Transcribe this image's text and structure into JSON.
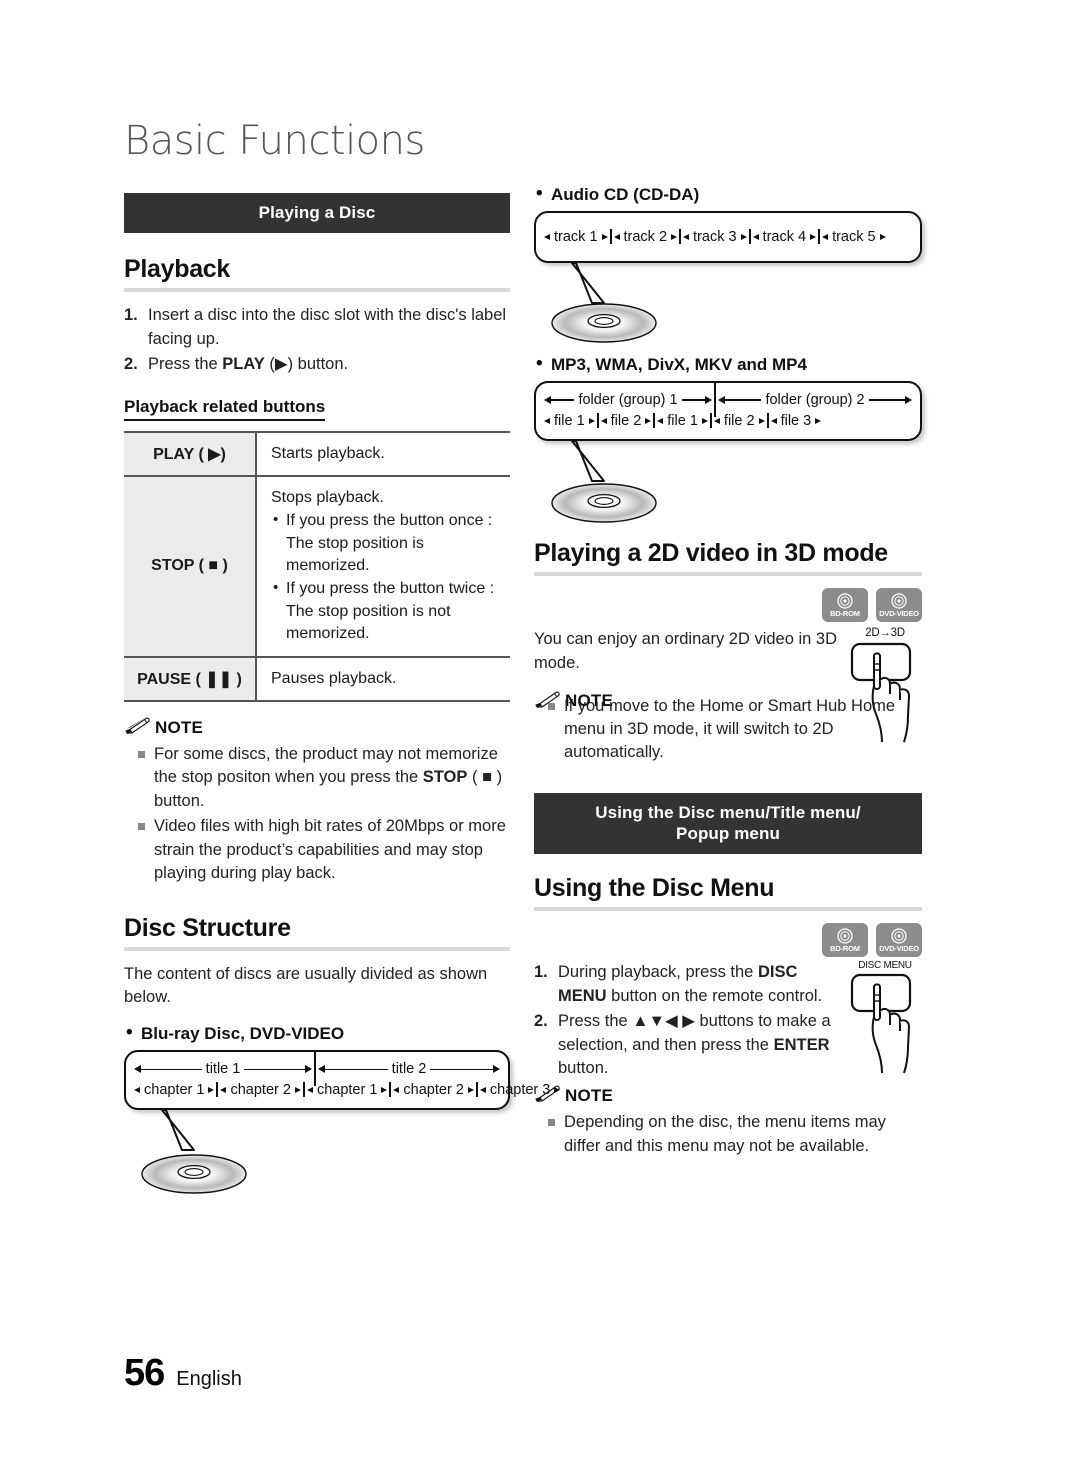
{
  "chapter": {
    "title": "Basic Functions"
  },
  "footer": {
    "page_number": "56",
    "language": "English"
  },
  "left": {
    "section_bar": "Playing a Disc",
    "playback": {
      "heading": "Playback",
      "steps": [
        {
          "num": "1.",
          "text": "Insert a disc into the disc slot with the disc's label facing up."
        },
        {
          "num": "2.",
          "pre": "Press the ",
          "bold": "PLAY",
          "post": " (▶) button."
        }
      ]
    },
    "related_buttons": {
      "heading": "Playback related buttons",
      "rows": [
        {
          "key": "PLAY ( ▶)",
          "desc": "Starts playback.",
          "bullets": []
        },
        {
          "key": "STOP ( ■ )",
          "desc": "Stops playback.",
          "bullets": [
            "If you press the button once : The stop position is memorized.",
            "If you press the button twice : The stop position is not memorized."
          ]
        },
        {
          "key": "PAUSE ( ❚❚ )",
          "desc": "Pauses playback.",
          "bullets": []
        }
      ]
    },
    "note": {
      "label": "NOTE",
      "items": [
        "For some discs, the product may not memorize the stop positon when you press the STOP ( ■ ) button.",
        "Video files with high bit rates of 20Mbps or more strain the product’s capabilities and may stop playing during play back."
      ]
    },
    "disc_structure": {
      "heading": "Disc Structure",
      "intro": "The content of discs are usually divided as shown below.",
      "bullet_title": "Blu-ray Disc, DVD-VIDEO",
      "titles": [
        "title 1",
        "title 2"
      ],
      "chapters_title1": [
        "chapter 1",
        "chapter 2"
      ],
      "chapters_title2": [
        "chapter 1",
        "chapter 2",
        "chapter 3"
      ]
    }
  },
  "right": {
    "audio_cd": {
      "bullet_title": "Audio CD (CD-DA)",
      "tracks": [
        "track 1",
        "track 2",
        "track 3",
        "track 4",
        "track 5"
      ]
    },
    "media_files": {
      "bullet_title": "MP3, WMA, DivX, MKV and MP4",
      "folders": [
        "folder (group) 1",
        "folder (group) 2"
      ],
      "files_group1": [
        "file 1",
        "file 2"
      ],
      "files_group2": [
        "file 1",
        "file 2",
        "file 3"
      ]
    },
    "two_d_three_d": {
      "heading": "Playing a 2D video in 3D mode",
      "badges": [
        "BD-ROM",
        "DVD-VIDEO"
      ],
      "body": "You can enjoy an ordinary 2D video in 3D mode.",
      "remote_key": "2D→3D",
      "note": {
        "label": "NOTE",
        "items": [
          "If you move to the Home or Smart Hub Home menu in 3D mode, it will switch to 2D automatically."
        ]
      }
    },
    "disc_menu": {
      "section_bar": "Using the Disc menu/Title menu/ Popup menu",
      "section_bar_line1": "Using the Disc menu/Title menu/",
      "section_bar_line2": "Popup menu",
      "heading": "Using the Disc Menu",
      "badges": [
        "BD-ROM",
        "DVD-VIDEO"
      ],
      "remote_key": "DISC MENU",
      "steps": [
        {
          "num": "1.",
          "pre": "During playback, press the ",
          "bold": "DISC MENU",
          "post": " button on the remote control."
        },
        {
          "num": "2.",
          "pre": "Press the ▲▼◀ ▶ buttons to make a selection, and then press the ",
          "bold": "ENTER",
          "post": " button."
        }
      ],
      "note": {
        "label": "NOTE",
        "items": [
          "Depending on the disc, the menu items may differ and this menu may not be available."
        ]
      }
    }
  },
  "colors": {
    "section_bar_bg": "#333333",
    "rule_gray": "#d9d9d9",
    "table_key_bg": "#ebebeb",
    "badge_bg": "#8c8c8c"
  }
}
